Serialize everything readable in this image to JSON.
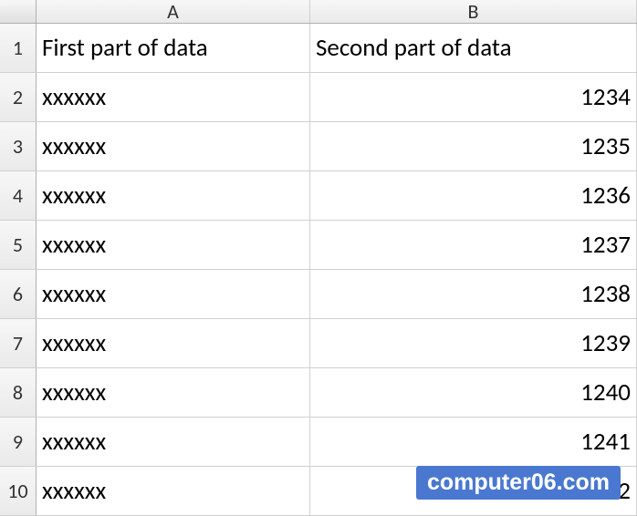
{
  "columns": {
    "A": "A",
    "B": "B"
  },
  "headers": {
    "A": "First part of data",
    "B": "Second part of data"
  },
  "rows": [
    {
      "n": "1"
    },
    {
      "n": "2",
      "A": "xxxxxx",
      "B": "1234"
    },
    {
      "n": "3",
      "A": "xxxxxx",
      "B": "1235"
    },
    {
      "n": "4",
      "A": "xxxxxx",
      "B": "1236"
    },
    {
      "n": "5",
      "A": "xxxxxx",
      "B": "1237"
    },
    {
      "n": "6",
      "A": "xxxxxx",
      "B": "1238"
    },
    {
      "n": "7",
      "A": "xxxxxx",
      "B": "1239"
    },
    {
      "n": "8",
      "A": "xxxxxx",
      "B": "1240"
    },
    {
      "n": "9",
      "A": "xxxxxx",
      "B": "1241"
    },
    {
      "n": "10",
      "A": "xxxxxx",
      "B": "1242"
    }
  ],
  "watermark": "computer06.com"
}
